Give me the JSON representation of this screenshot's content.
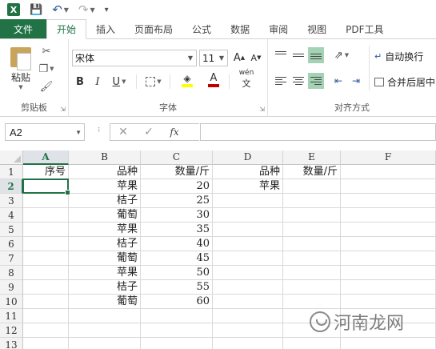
{
  "qat": {
    "logo": "X"
  },
  "tabs": [
    {
      "label": "文件"
    },
    {
      "label": "开始"
    },
    {
      "label": "插入"
    },
    {
      "label": "页面布局"
    },
    {
      "label": "公式"
    },
    {
      "label": "数据"
    },
    {
      "label": "审阅"
    },
    {
      "label": "视图"
    },
    {
      "label": "PDF工具"
    }
  ],
  "ribbon": {
    "clipboard": {
      "paste_label": "粘贴",
      "group_label": "剪贴板"
    },
    "font": {
      "name": "宋体",
      "size": "11",
      "bold": "B",
      "italic": "I",
      "underline": "U",
      "phonetic": "wén",
      "group_label": "字体",
      "grow": "A",
      "shrink": "A",
      "font_color_glyph": "A"
    },
    "alignment": {
      "wrap_label": "自动换行",
      "merge_label": "合并后居中",
      "group_label": "对齐方式"
    }
  },
  "formula_bar": {
    "name_box": "A2",
    "fx": "fx",
    "cancel": "✕",
    "enter": "✓",
    "value": ""
  },
  "columns": [
    "A",
    "B",
    "C",
    "D",
    "E",
    "F"
  ],
  "rows": [
    "1",
    "2",
    "3",
    "4",
    "5",
    "6",
    "7",
    "8",
    "9",
    "10",
    "11",
    "12",
    "13"
  ],
  "cells": {
    "A1": "序号",
    "B1": "品种",
    "C1": "数量/斤",
    "D1": "品种",
    "E1": "数量/斤",
    "B2": "苹果",
    "C2": "20",
    "D2": "苹果",
    "B3": "桔子",
    "C3": "25",
    "B4": "葡萄",
    "C4": "30",
    "B5": "苹果",
    "C5": "35",
    "B6": "桔子",
    "C6": "40",
    "B7": "葡萄",
    "C7": "45",
    "B8": "苹果",
    "C8": "50",
    "B9": "桔子",
    "C9": "55",
    "B10": "葡萄",
    "C10": "60"
  },
  "selected_cell": "A2",
  "watermark": "河南龙网",
  "colors": {
    "excel_green": "#217346",
    "selection_fill": "#a3d3b4",
    "font_red": "#c00000",
    "highlight_yellow": "#ffff00"
  }
}
